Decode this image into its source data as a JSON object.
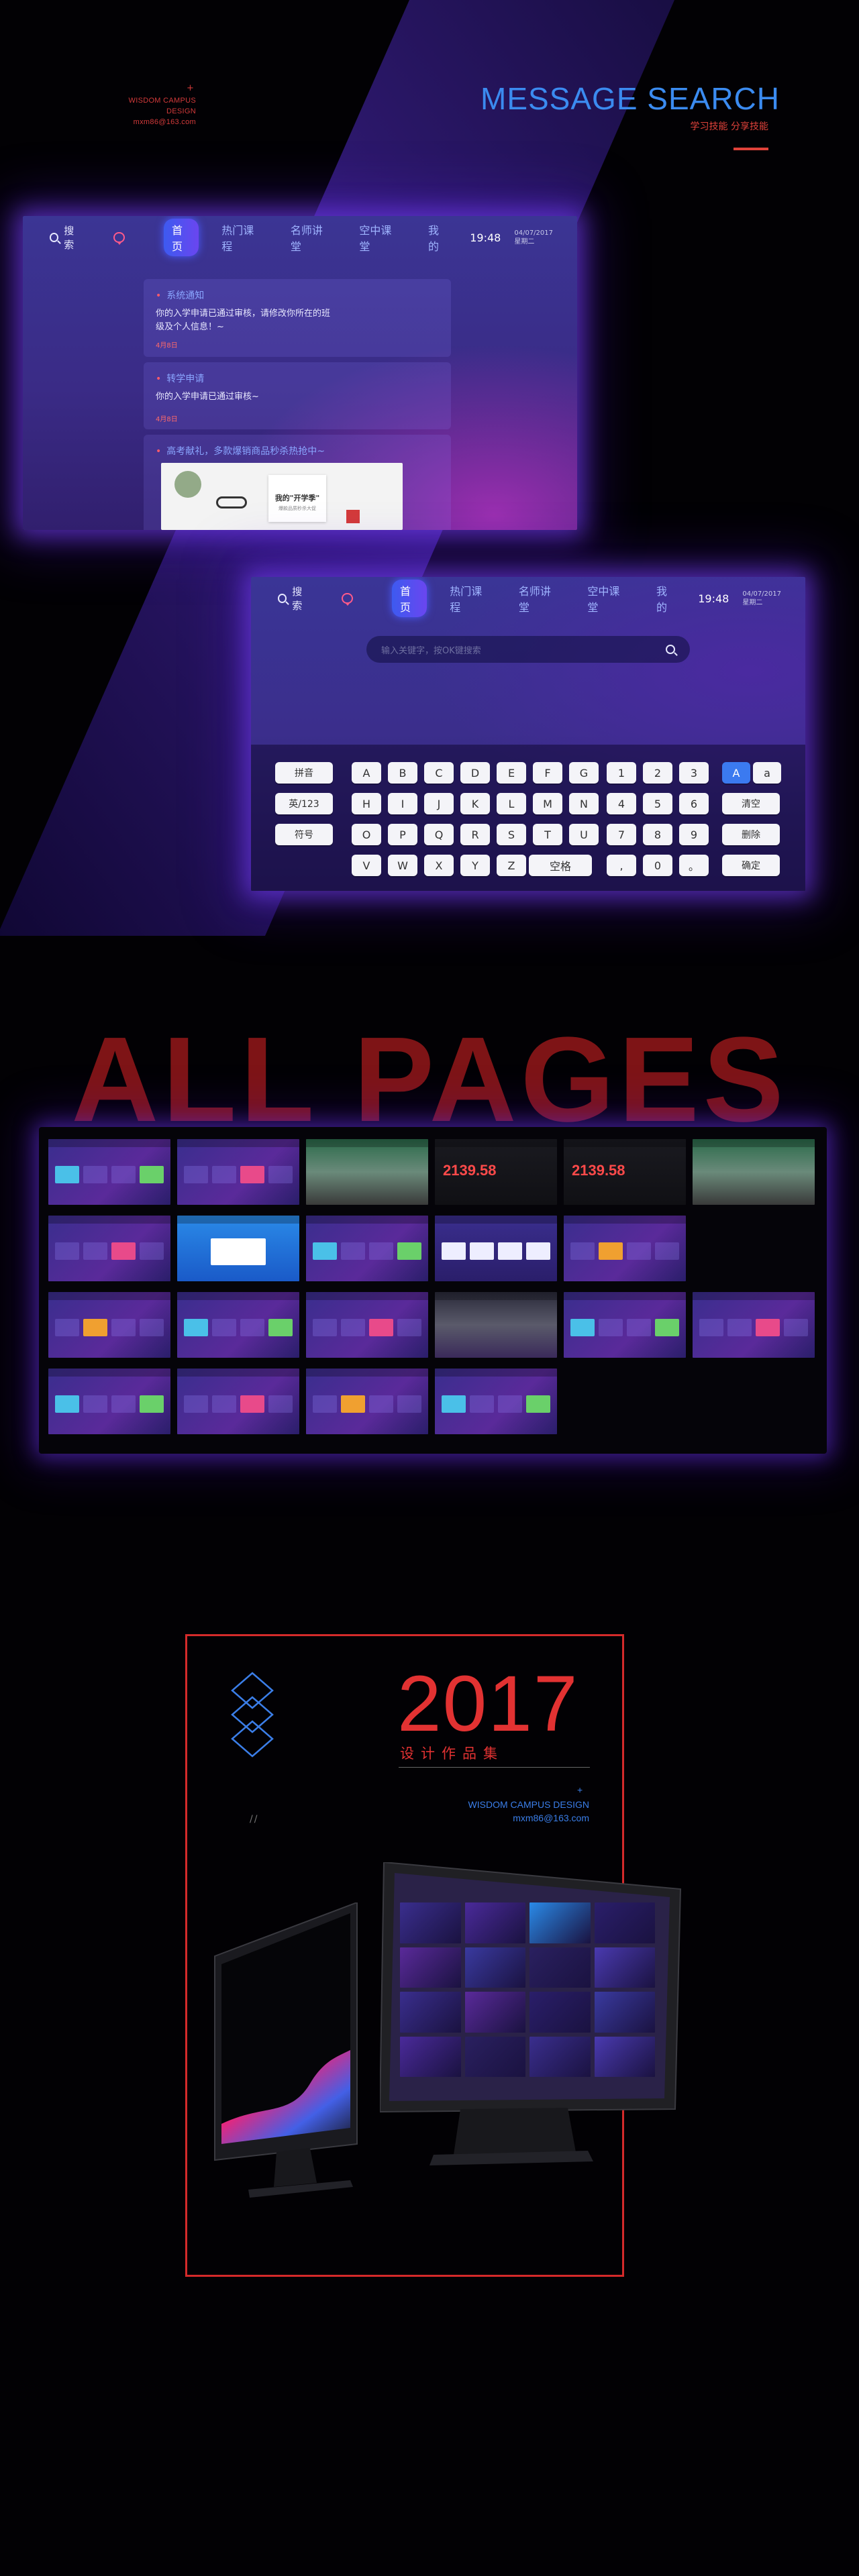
{
  "header": {
    "brand_plus": "+",
    "brand_line1": "WISDOM CAMPUS DESIGN",
    "brand_line2": "mxm86@163.com",
    "title": "MESSAGE SEARCH",
    "subtitle": "学习技能 分享技能"
  },
  "nav": {
    "search_label": "搜索",
    "tabs": [
      "首页",
      "热门课程",
      "名师讲堂",
      "空中课堂",
      "我的"
    ],
    "time": "19:48",
    "date_line1": "04/07/2017",
    "date_line2": "星期二"
  },
  "messages": [
    {
      "title": "系统通知",
      "body_line1": "你的入学申请已通过审核，请修改你所在的班",
      "body_line2": "级及个人信息！~",
      "date": "4月8日"
    },
    {
      "title": "转学申请",
      "body_line1": "你的入学申请已通过审核~",
      "body_line2": "",
      "date": "4月8日"
    },
    {
      "title": "高考献礼，多款爆销商品秒杀热抢中~",
      "body_line1": "",
      "body_line2": "",
      "date": ""
    }
  ],
  "promo": {
    "headline": "我的\"开学季\"",
    "tagline": "爆款品质秒杀大促"
  },
  "search": {
    "placeholder": "输入关键字，按OK键搜索"
  },
  "keyboard": {
    "mode_keys": [
      "拼音",
      "英/123",
      "符号"
    ],
    "letter_rows": [
      [
        "A",
        "B",
        "C",
        "D",
        "E",
        "F",
        "G"
      ],
      [
        "H",
        "I",
        "J",
        "K",
        "L",
        "M",
        "N"
      ],
      [
        "O",
        "P",
        "Q",
        "R",
        "S",
        "T",
        "U"
      ],
      [
        "V",
        "W",
        "X",
        "Y",
        "Z"
      ]
    ],
    "space_label": "空格",
    "number_rows": [
      [
        "1",
        "2",
        "3"
      ],
      [
        "4",
        "5",
        "6"
      ],
      [
        "7",
        "8",
        "9"
      ],
      [
        ",",
        "0",
        "。"
      ]
    ],
    "case_upper": "A",
    "case_lower": "a",
    "clear_label": "清空",
    "delete_label": "删除",
    "confirm_label": "确定"
  },
  "all_pages": {
    "heading": "ALL PAGES",
    "thumb_price": "2139.58"
  },
  "poster": {
    "year": "2017",
    "subtitle": "设计作品集",
    "plus": "+",
    "en_line1": "WISDOM CAMPUS DESIGN",
    "en_line2": "mxm86@163.com",
    "slash": "//"
  },
  "colors": {
    "accent_blue": "#3b8bf0",
    "accent_red": "#e0423a",
    "screen_purple": "#3a2a8a",
    "glow": "#6a3ce6"
  }
}
